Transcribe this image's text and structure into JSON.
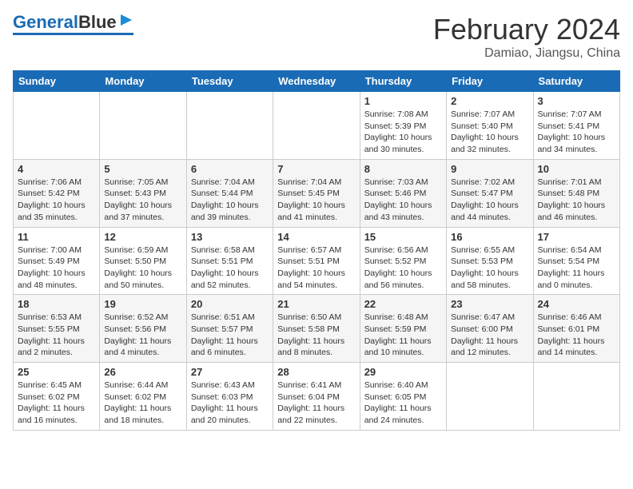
{
  "header": {
    "logo_general": "General",
    "logo_blue": "Blue",
    "month_year": "February 2024",
    "location": "Damiao, Jiangsu, China"
  },
  "weekdays": [
    "Sunday",
    "Monday",
    "Tuesday",
    "Wednesday",
    "Thursday",
    "Friday",
    "Saturday"
  ],
  "weeks": [
    [
      {
        "day": "",
        "info": ""
      },
      {
        "day": "",
        "info": ""
      },
      {
        "day": "",
        "info": ""
      },
      {
        "day": "",
        "info": ""
      },
      {
        "day": "1",
        "info": "Sunrise: 7:08 AM\nSunset: 5:39 PM\nDaylight: 10 hours\nand 30 minutes."
      },
      {
        "day": "2",
        "info": "Sunrise: 7:07 AM\nSunset: 5:40 PM\nDaylight: 10 hours\nand 32 minutes."
      },
      {
        "day": "3",
        "info": "Sunrise: 7:07 AM\nSunset: 5:41 PM\nDaylight: 10 hours\nand 34 minutes."
      }
    ],
    [
      {
        "day": "4",
        "info": "Sunrise: 7:06 AM\nSunset: 5:42 PM\nDaylight: 10 hours\nand 35 minutes."
      },
      {
        "day": "5",
        "info": "Sunrise: 7:05 AM\nSunset: 5:43 PM\nDaylight: 10 hours\nand 37 minutes."
      },
      {
        "day": "6",
        "info": "Sunrise: 7:04 AM\nSunset: 5:44 PM\nDaylight: 10 hours\nand 39 minutes."
      },
      {
        "day": "7",
        "info": "Sunrise: 7:04 AM\nSunset: 5:45 PM\nDaylight: 10 hours\nand 41 minutes."
      },
      {
        "day": "8",
        "info": "Sunrise: 7:03 AM\nSunset: 5:46 PM\nDaylight: 10 hours\nand 43 minutes."
      },
      {
        "day": "9",
        "info": "Sunrise: 7:02 AM\nSunset: 5:47 PM\nDaylight: 10 hours\nand 44 minutes."
      },
      {
        "day": "10",
        "info": "Sunrise: 7:01 AM\nSunset: 5:48 PM\nDaylight: 10 hours\nand 46 minutes."
      }
    ],
    [
      {
        "day": "11",
        "info": "Sunrise: 7:00 AM\nSunset: 5:49 PM\nDaylight: 10 hours\nand 48 minutes."
      },
      {
        "day": "12",
        "info": "Sunrise: 6:59 AM\nSunset: 5:50 PM\nDaylight: 10 hours\nand 50 minutes."
      },
      {
        "day": "13",
        "info": "Sunrise: 6:58 AM\nSunset: 5:51 PM\nDaylight: 10 hours\nand 52 minutes."
      },
      {
        "day": "14",
        "info": "Sunrise: 6:57 AM\nSunset: 5:51 PM\nDaylight: 10 hours\nand 54 minutes."
      },
      {
        "day": "15",
        "info": "Sunrise: 6:56 AM\nSunset: 5:52 PM\nDaylight: 10 hours\nand 56 minutes."
      },
      {
        "day": "16",
        "info": "Sunrise: 6:55 AM\nSunset: 5:53 PM\nDaylight: 10 hours\nand 58 minutes."
      },
      {
        "day": "17",
        "info": "Sunrise: 6:54 AM\nSunset: 5:54 PM\nDaylight: 11 hours\nand 0 minutes."
      }
    ],
    [
      {
        "day": "18",
        "info": "Sunrise: 6:53 AM\nSunset: 5:55 PM\nDaylight: 11 hours\nand 2 minutes."
      },
      {
        "day": "19",
        "info": "Sunrise: 6:52 AM\nSunset: 5:56 PM\nDaylight: 11 hours\nand 4 minutes."
      },
      {
        "day": "20",
        "info": "Sunrise: 6:51 AM\nSunset: 5:57 PM\nDaylight: 11 hours\nand 6 minutes."
      },
      {
        "day": "21",
        "info": "Sunrise: 6:50 AM\nSunset: 5:58 PM\nDaylight: 11 hours\nand 8 minutes."
      },
      {
        "day": "22",
        "info": "Sunrise: 6:48 AM\nSunset: 5:59 PM\nDaylight: 11 hours\nand 10 minutes."
      },
      {
        "day": "23",
        "info": "Sunrise: 6:47 AM\nSunset: 6:00 PM\nDaylight: 11 hours\nand 12 minutes."
      },
      {
        "day": "24",
        "info": "Sunrise: 6:46 AM\nSunset: 6:01 PM\nDaylight: 11 hours\nand 14 minutes."
      }
    ],
    [
      {
        "day": "25",
        "info": "Sunrise: 6:45 AM\nSunset: 6:02 PM\nDaylight: 11 hours\nand 16 minutes."
      },
      {
        "day": "26",
        "info": "Sunrise: 6:44 AM\nSunset: 6:02 PM\nDaylight: 11 hours\nand 18 minutes."
      },
      {
        "day": "27",
        "info": "Sunrise: 6:43 AM\nSunset: 6:03 PM\nDaylight: 11 hours\nand 20 minutes."
      },
      {
        "day": "28",
        "info": "Sunrise: 6:41 AM\nSunset: 6:04 PM\nDaylight: 11 hours\nand 22 minutes."
      },
      {
        "day": "29",
        "info": "Sunrise: 6:40 AM\nSunset: 6:05 PM\nDaylight: 11 hours\nand 24 minutes."
      },
      {
        "day": "",
        "info": ""
      },
      {
        "day": "",
        "info": ""
      }
    ]
  ]
}
